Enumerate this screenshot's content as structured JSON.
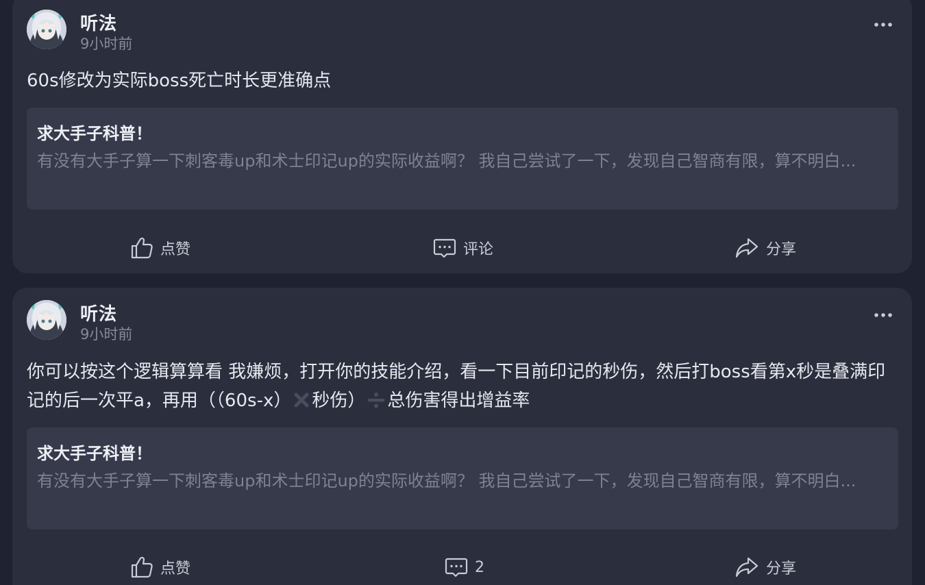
{
  "posts": [
    {
      "author": "听法",
      "time": "9小时前",
      "text": "60s修改为实际boss死亡时长更准确点",
      "quote": {
        "title": "求大手子科普！",
        "excerpt": "有没有大手子算一下刺客毒up和术士印记up的实际收益啊？ 我自己尝试了一下，发现自己智商有限，算不明白..."
      },
      "actions": {
        "like_label": "点赞",
        "comment_label": "评论",
        "share_label": "分享"
      }
    },
    {
      "author": "听法",
      "time": "9小时前",
      "text_part1": "你可以按这个逻辑算算看 我嫌烦，打开你的技能介绍，看一下目前印记的秒伤，然后打boss看第x秒是叠满印记的后一次平a，再用（（60s-x）",
      "text_part2": "秒伤）",
      "text_part3": "总伤害得出增益率",
      "inline_icons": [
        "multiply-icon",
        "divide-icon"
      ],
      "quote": {
        "title": "求大手子科普！",
        "excerpt": "有没有大手子算一下刺客毒up和术士印记up的实际收益啊？ 我自己尝试了一下，发现自己智商有限，算不明白..."
      },
      "actions": {
        "like_label": "点赞",
        "comment_count": "2",
        "share_label": "分享"
      }
    }
  ],
  "colors": {
    "background": "#1f2230",
    "card": "#2b2e3d",
    "quote_box": "#363a4b",
    "text_primary": "#e6e8ee",
    "text_secondary": "#868b9b",
    "text_quote": "#7d8294"
  }
}
